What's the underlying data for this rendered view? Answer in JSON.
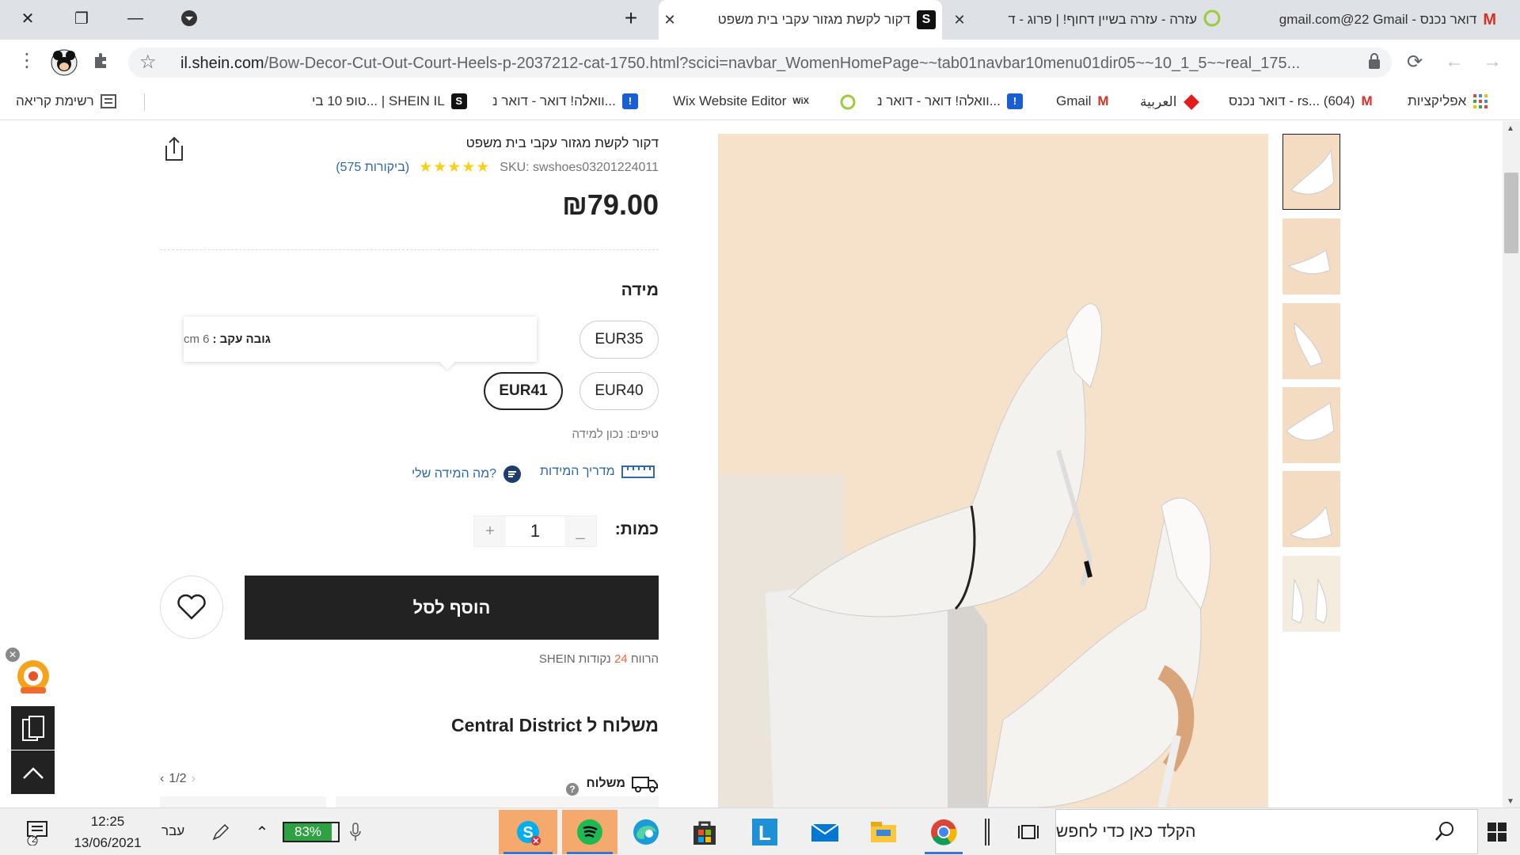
{
  "browser": {
    "tabs": [
      {
        "title": "דואר נכנס - Gmail ‏22@gmail.com",
        "favicon": "M",
        "active": false
      },
      {
        "title": "עזרה - עזרה בשיין דחוף! | פרוג - ד",
        "favicon": "wix-icon",
        "active": false
      },
      {
        "title": "דקור לקשת מגזור עקבי בית משפט",
        "favicon": "S",
        "active": true
      }
    ],
    "url_host": "il.shein.com",
    "url_path": "/Bow-Decor-Cut-Out-Court-Heels-p-2037212-cat-1750.html?scici=navbar_WomenHomePage~~tab01navbar10menu01dir05~~10_1_5~~real_175...",
    "bookmarks": [
      {
        "label": "אפליקציות",
        "icon": "apps-icon"
      },
      {
        "label": "דואר נכנס - rs... (604)",
        "icon": "M"
      },
      {
        "label": "العربية",
        "icon": "diamond-icon"
      },
      {
        "label": "Gmail",
        "icon": "M"
      },
      {
        "label": "וואלה! דואר - דואר נ...",
        "icon": "!"
      },
      {
        "label": "",
        "icon": "wix-circle-icon"
      },
      {
        "label": "Wix Website Editor",
        "icon": "WiX"
      },
      {
        "label": "וואלה! דואר - דואר נ...",
        "icon": "!"
      },
      {
        "label": "טופ 10 בי... | SHEIN IL",
        "icon": "S"
      }
    ],
    "reading_list": "רשימת קריאה"
  },
  "product": {
    "title": "דקור לקשת מגזור עקבי בית משפט",
    "sku": "SKU: swshoes03201224011",
    "rating_stars": "★★★★★",
    "reviews": "(575 ביקורות)",
    "price": "₪79.00",
    "size_label": "מידה",
    "sizes": [
      "EUR35",
      "EUR40",
      "EUR41"
    ],
    "selected_size": "EUR41",
    "tooltip_label": "גובה עקב :",
    "tooltip_value": "6 cm",
    "tips": "טיפים: נכון למידה",
    "size_guide": "מדריך המידות",
    "my_size": "מה המידה שלי?",
    "qty_label": "כמות:",
    "qty_value": "1",
    "qty_minus": "_",
    "qty_plus": "+",
    "add_to_cart": "הוסף לסל",
    "points_prefix": "הרווח",
    "points_num": "24",
    "points_suffix": "נקודות SHEIN",
    "shipping_title": "משלוח ל Central District",
    "shipping_label": "משלוח",
    "pager": "1/2"
  },
  "taskbar": {
    "search_placeholder": "הקלד כאן כדי לחפש",
    "time": "12:25",
    "date": "13/06/2021",
    "lang": "עבר",
    "battery": "83%",
    "notifications": "2"
  },
  "colors": {
    "accent_link": "#2d68a8",
    "stars": "#facf19",
    "cta": "#222222",
    "points": "#fa6338",
    "image_bg": "#f6e2ca"
  }
}
